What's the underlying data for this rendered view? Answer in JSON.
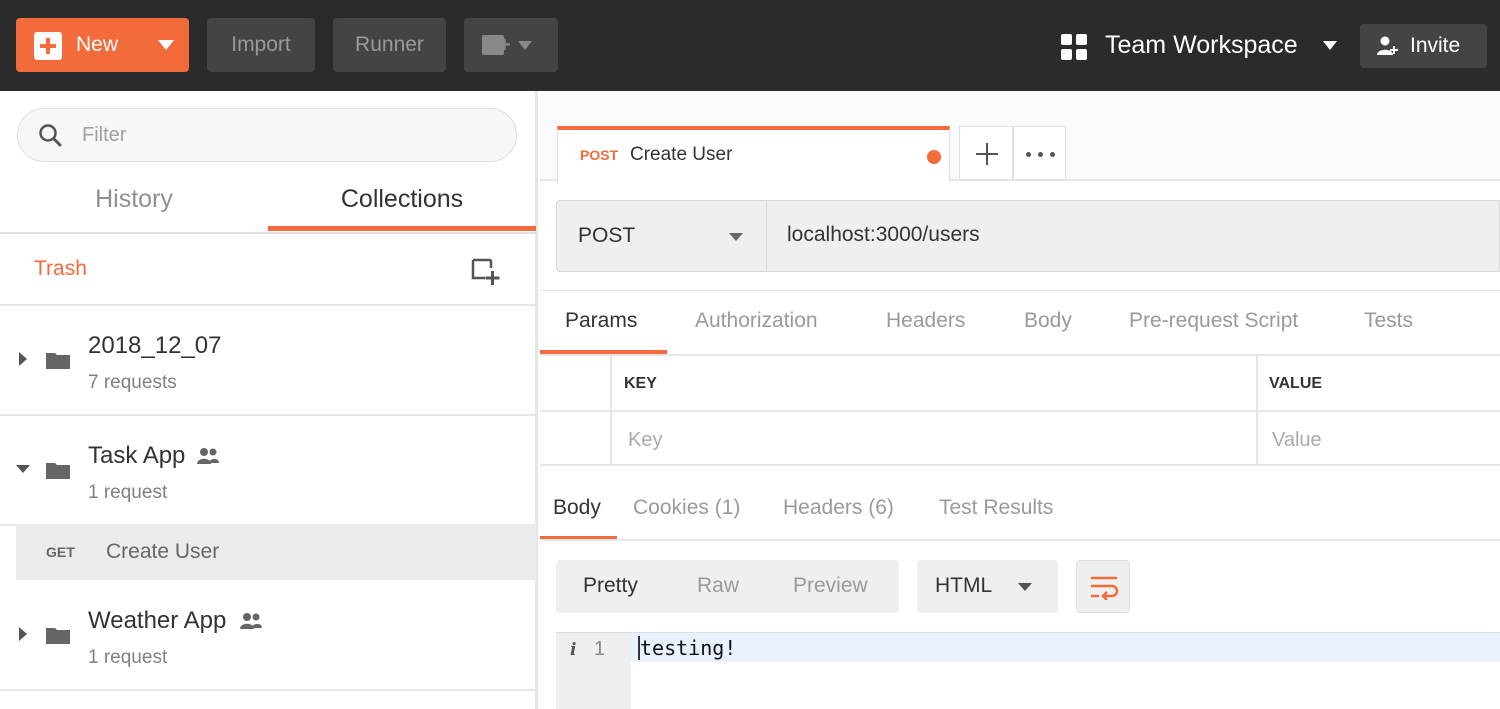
{
  "topbar": {
    "new_label": "New",
    "import_label": "Import",
    "runner_label": "Runner",
    "workspace_label": "Team Workspace",
    "invite_label": "Invite"
  },
  "sidebar": {
    "filter_placeholder": "Filter",
    "tabs": [
      "History",
      "Collections"
    ],
    "active_tab": "Collections",
    "trash_label": "Trash",
    "collections": [
      {
        "name": "2018_12_07",
        "count": "7 requests",
        "expanded": false,
        "shared": false
      },
      {
        "name": "Task App",
        "count": "1 request",
        "expanded": true,
        "shared": true,
        "requests": [
          {
            "method": "GET",
            "name": "Create User"
          }
        ]
      },
      {
        "name": "Weather App",
        "count": "1 request",
        "expanded": false,
        "shared": true
      }
    ]
  },
  "main": {
    "tab": {
      "method": "POST",
      "name": "Create User",
      "unsaved": true
    },
    "request": {
      "method": "POST",
      "url": "localhost:3000/users"
    },
    "param_tabs": [
      "Params",
      "Authorization",
      "Headers",
      "Body",
      "Pre-request Script",
      "Tests"
    ],
    "params_table": {
      "key_header": "KEY",
      "value_header": "VALUE",
      "key_placeholder": "Key",
      "value_placeholder": "Value"
    },
    "response_tabs": [
      "Body",
      "Cookies (1)",
      "Headers (6)",
      "Test Results"
    ],
    "format_options": [
      "Pretty",
      "Raw",
      "Preview"
    ],
    "active_format": "Pretty",
    "language": "HTML",
    "editor": {
      "line_number": "1",
      "code": "testing!"
    }
  },
  "colors": {
    "accent": "#f26b3a",
    "topbar": "#2b2b2b"
  }
}
